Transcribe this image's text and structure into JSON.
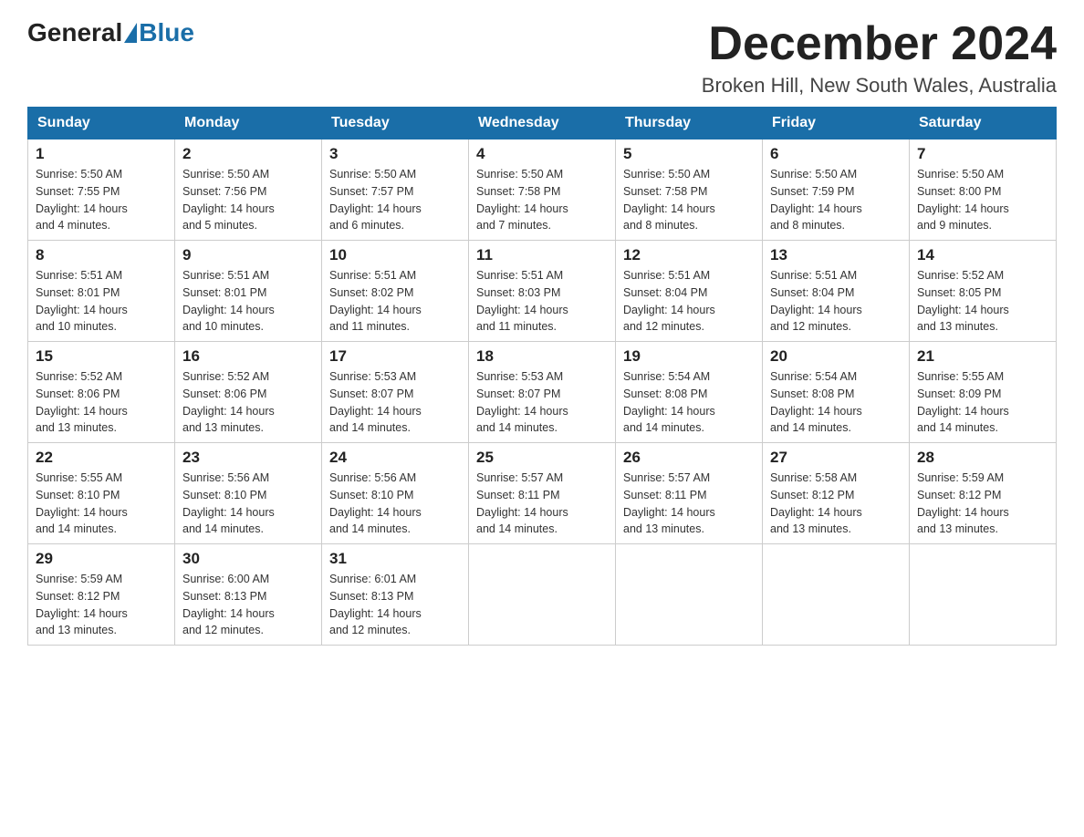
{
  "header": {
    "logo_general": "General",
    "logo_blue": "Blue",
    "title": "December 2024",
    "subtitle": "Broken Hill, New South Wales, Australia"
  },
  "weekdays": [
    "Sunday",
    "Monday",
    "Tuesday",
    "Wednesday",
    "Thursday",
    "Friday",
    "Saturday"
  ],
  "weeks": [
    [
      {
        "day": "1",
        "sunrise": "5:50 AM",
        "sunset": "7:55 PM",
        "daylight": "14 hours and 4 minutes."
      },
      {
        "day": "2",
        "sunrise": "5:50 AM",
        "sunset": "7:56 PM",
        "daylight": "14 hours and 5 minutes."
      },
      {
        "day": "3",
        "sunrise": "5:50 AM",
        "sunset": "7:57 PM",
        "daylight": "14 hours and 6 minutes."
      },
      {
        "day": "4",
        "sunrise": "5:50 AM",
        "sunset": "7:58 PM",
        "daylight": "14 hours and 7 minutes."
      },
      {
        "day": "5",
        "sunrise": "5:50 AM",
        "sunset": "7:58 PM",
        "daylight": "14 hours and 8 minutes."
      },
      {
        "day": "6",
        "sunrise": "5:50 AM",
        "sunset": "7:59 PM",
        "daylight": "14 hours and 8 minutes."
      },
      {
        "day": "7",
        "sunrise": "5:50 AM",
        "sunset": "8:00 PM",
        "daylight": "14 hours and 9 minutes."
      }
    ],
    [
      {
        "day": "8",
        "sunrise": "5:51 AM",
        "sunset": "8:01 PM",
        "daylight": "14 hours and 10 minutes."
      },
      {
        "day": "9",
        "sunrise": "5:51 AM",
        "sunset": "8:01 PM",
        "daylight": "14 hours and 10 minutes."
      },
      {
        "day": "10",
        "sunrise": "5:51 AM",
        "sunset": "8:02 PM",
        "daylight": "14 hours and 11 minutes."
      },
      {
        "day": "11",
        "sunrise": "5:51 AM",
        "sunset": "8:03 PM",
        "daylight": "14 hours and 11 minutes."
      },
      {
        "day": "12",
        "sunrise": "5:51 AM",
        "sunset": "8:04 PM",
        "daylight": "14 hours and 12 minutes."
      },
      {
        "day": "13",
        "sunrise": "5:51 AM",
        "sunset": "8:04 PM",
        "daylight": "14 hours and 12 minutes."
      },
      {
        "day": "14",
        "sunrise": "5:52 AM",
        "sunset": "8:05 PM",
        "daylight": "14 hours and 13 minutes."
      }
    ],
    [
      {
        "day": "15",
        "sunrise": "5:52 AM",
        "sunset": "8:06 PM",
        "daylight": "14 hours and 13 minutes."
      },
      {
        "day": "16",
        "sunrise": "5:52 AM",
        "sunset": "8:06 PM",
        "daylight": "14 hours and 13 minutes."
      },
      {
        "day": "17",
        "sunrise": "5:53 AM",
        "sunset": "8:07 PM",
        "daylight": "14 hours and 14 minutes."
      },
      {
        "day": "18",
        "sunrise": "5:53 AM",
        "sunset": "8:07 PM",
        "daylight": "14 hours and 14 minutes."
      },
      {
        "day": "19",
        "sunrise": "5:54 AM",
        "sunset": "8:08 PM",
        "daylight": "14 hours and 14 minutes."
      },
      {
        "day": "20",
        "sunrise": "5:54 AM",
        "sunset": "8:08 PM",
        "daylight": "14 hours and 14 minutes."
      },
      {
        "day": "21",
        "sunrise": "5:55 AM",
        "sunset": "8:09 PM",
        "daylight": "14 hours and 14 minutes."
      }
    ],
    [
      {
        "day": "22",
        "sunrise": "5:55 AM",
        "sunset": "8:10 PM",
        "daylight": "14 hours and 14 minutes."
      },
      {
        "day": "23",
        "sunrise": "5:56 AM",
        "sunset": "8:10 PM",
        "daylight": "14 hours and 14 minutes."
      },
      {
        "day": "24",
        "sunrise": "5:56 AM",
        "sunset": "8:10 PM",
        "daylight": "14 hours and 14 minutes."
      },
      {
        "day": "25",
        "sunrise": "5:57 AM",
        "sunset": "8:11 PM",
        "daylight": "14 hours and 14 minutes."
      },
      {
        "day": "26",
        "sunrise": "5:57 AM",
        "sunset": "8:11 PM",
        "daylight": "14 hours and 13 minutes."
      },
      {
        "day": "27",
        "sunrise": "5:58 AM",
        "sunset": "8:12 PM",
        "daylight": "14 hours and 13 minutes."
      },
      {
        "day": "28",
        "sunrise": "5:59 AM",
        "sunset": "8:12 PM",
        "daylight": "14 hours and 13 minutes."
      }
    ],
    [
      {
        "day": "29",
        "sunrise": "5:59 AM",
        "sunset": "8:12 PM",
        "daylight": "14 hours and 13 minutes."
      },
      {
        "day": "30",
        "sunrise": "6:00 AM",
        "sunset": "8:13 PM",
        "daylight": "14 hours and 12 minutes."
      },
      {
        "day": "31",
        "sunrise": "6:01 AM",
        "sunset": "8:13 PM",
        "daylight": "14 hours and 12 minutes."
      },
      null,
      null,
      null,
      null
    ]
  ],
  "labels": {
    "sunrise": "Sunrise:",
    "sunset": "Sunset:",
    "daylight": "Daylight:"
  }
}
